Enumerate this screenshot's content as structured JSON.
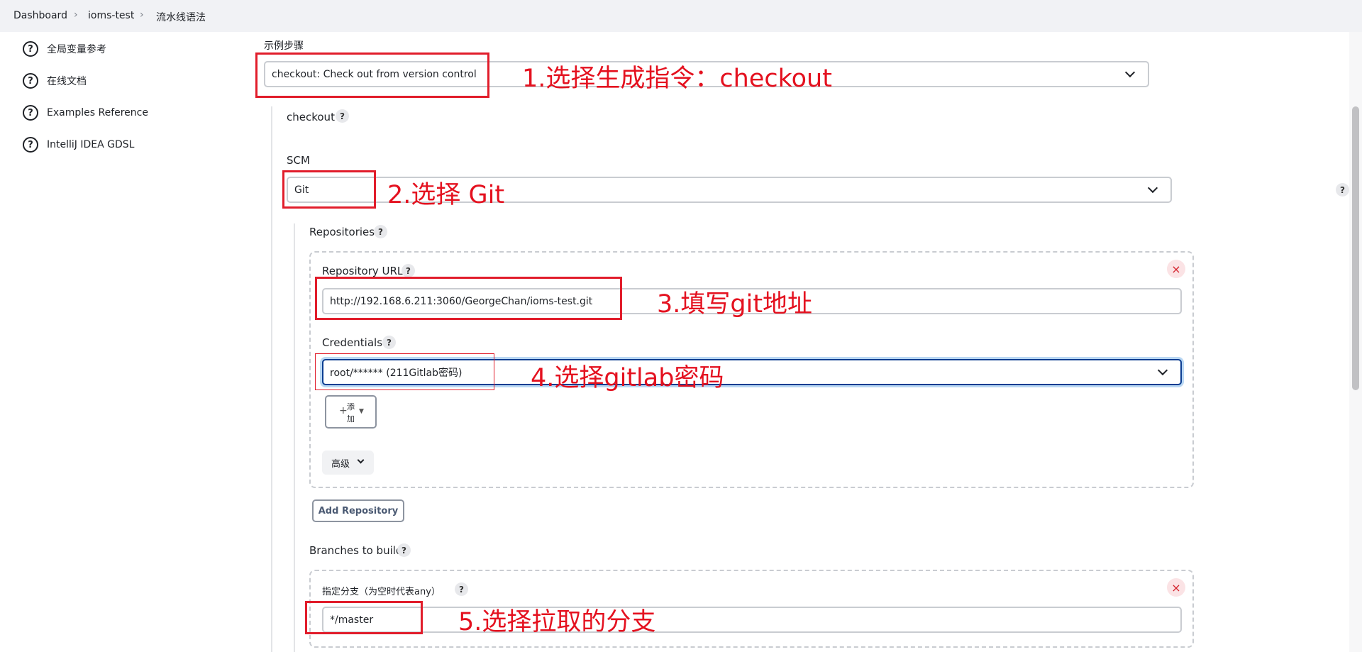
{
  "breadcrumb": {
    "items": [
      "Dashboard",
      "ioms-test",
      "流水线语法"
    ]
  },
  "sidebar": {
    "items": [
      {
        "label": "全局变量参考",
        "icon": "help-circle-icon"
      },
      {
        "label": "在线文档",
        "icon": "help-circle-icon"
      },
      {
        "label": "Examples Reference",
        "icon": "help-circle-icon"
      },
      {
        "label": "IntelliJ IDEA GDSL",
        "icon": "help-circle-icon"
      }
    ]
  },
  "sample_step": {
    "label": "示例步骤",
    "selected": "checkout: Check out from version control"
  },
  "checkout": {
    "label": "checkout",
    "help": "?"
  },
  "scm": {
    "label": "SCM",
    "selected": "Git",
    "help": "?"
  },
  "repositories": {
    "label": "Repositories",
    "help": "?",
    "url_label": "Repository URL",
    "url_value": "http://192.168.6.211:3060/GeorgeChan/ioms-test.git",
    "credentials_label": "Credentials",
    "credentials_selected": "root/****** (211Gitlab密码)",
    "add_label_line1": "添",
    "add_label_line2": "加",
    "advanced_label": "高级",
    "add_repository_label": "Add Repository",
    "remove": "×"
  },
  "branches": {
    "label": "Branches to build",
    "help": "?",
    "branch_label": "指定分支（为空时代表any）",
    "branch_value": "*/master",
    "remove": "×"
  },
  "annotations": [
    "1.选择生成指令：checkout",
    "2.选择 Git",
    "3.填写git地址",
    "4.选择gitlab密码",
    "5.选择拉取的分支"
  ],
  "colors": {
    "annotation": "#e4111f",
    "focus_border": "#0b3d91",
    "remove_button": "#d4232d"
  }
}
